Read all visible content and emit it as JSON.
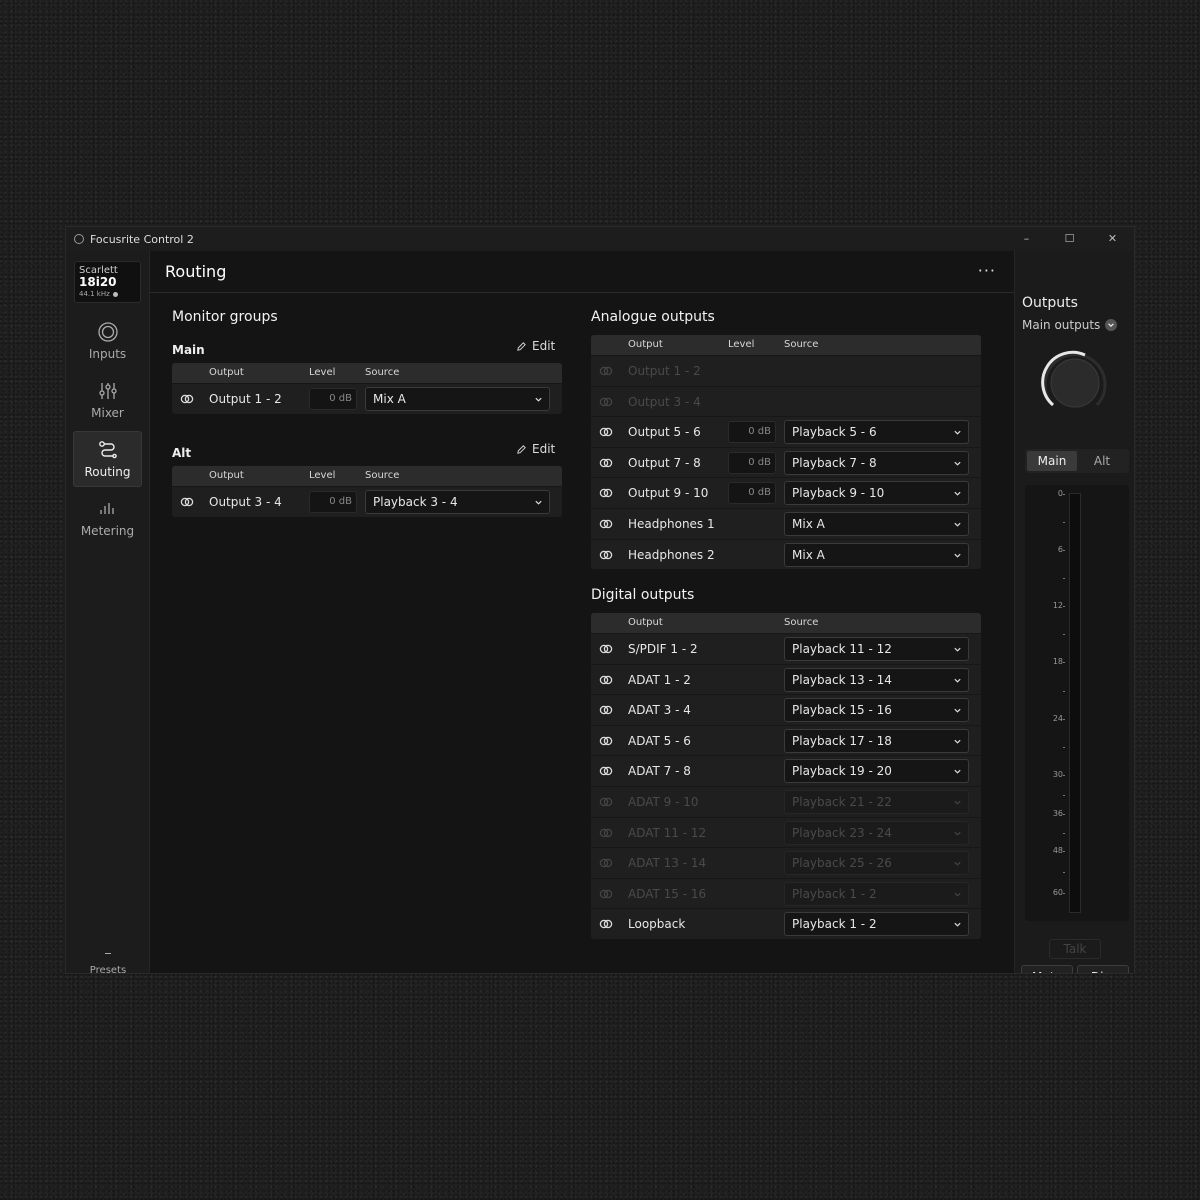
{
  "window": {
    "title": "Focusrite Control 2",
    "controls": [
      "–",
      "☐",
      "✕"
    ]
  },
  "sidebar": {
    "device": {
      "brand": "Scarlett",
      "model": "18i20",
      "rate": "44.1 kHz"
    },
    "items": [
      {
        "label": "Inputs",
        "icon": "inputs-icon"
      },
      {
        "label": "Mixer",
        "icon": "mixer-icon"
      },
      {
        "label": "Routing",
        "icon": "routing-icon"
      },
      {
        "label": "Metering",
        "icon": "metering-icon"
      }
    ],
    "presets": "Presets"
  },
  "page": {
    "title": "Routing",
    "more": "···"
  },
  "monitor": {
    "title": "Monitor groups",
    "edit_label": "Edit",
    "headers": {
      "output": "Output",
      "level": "Level",
      "source": "Source"
    },
    "main": {
      "title": "Main",
      "output": "Output 1 - 2",
      "level": "0 dB",
      "source": "Mix A"
    },
    "alt": {
      "title": "Alt",
      "output": "Output 3 - 4",
      "level": "0 dB",
      "source": "Playback 3 - 4"
    }
  },
  "analogue": {
    "title": "Analogue outputs",
    "headers": {
      "output": "Output",
      "level": "Level",
      "source": "Source"
    },
    "rows": [
      {
        "name": "Output 1 - 2",
        "level": "",
        "source": "",
        "disabled": true
      },
      {
        "name": "Output 3 - 4",
        "level": "",
        "source": "",
        "disabled": true
      },
      {
        "name": "Output 5 - 6",
        "level": "0 dB",
        "source": "Playback 5 - 6",
        "disabled": false
      },
      {
        "name": "Output 7 - 8",
        "level": "0 dB",
        "source": "Playback 7 - 8",
        "disabled": false
      },
      {
        "name": "Output 9 - 10",
        "level": "0 dB",
        "source": "Playback 9 - 10",
        "disabled": false
      },
      {
        "name": "Headphones 1",
        "level": "",
        "source": "Mix A",
        "disabled": false
      },
      {
        "name": "Headphones 2",
        "level": "",
        "source": "Mix A",
        "disabled": false
      }
    ]
  },
  "digital": {
    "title": "Digital outputs",
    "headers": {
      "output": "Output",
      "source": "Source"
    },
    "rows": [
      {
        "name": "S/PDIF 1 - 2",
        "source": "Playback 11 - 12",
        "disabled": false
      },
      {
        "name": "ADAT 1 - 2",
        "source": "Playback 13 - 14",
        "disabled": false
      },
      {
        "name": "ADAT 3 - 4",
        "source": "Playback 15 - 16",
        "disabled": false
      },
      {
        "name": "ADAT 5 - 6",
        "source": "Playback 17 - 18",
        "disabled": false
      },
      {
        "name": "ADAT 7 - 8",
        "source": "Playback 19 - 20",
        "disabled": false
      },
      {
        "name": "ADAT 9 - 10",
        "source": "Playback 21 - 22",
        "disabled": true
      },
      {
        "name": "ADAT 11 - 12",
        "source": "Playback 23 - 24",
        "disabled": true
      },
      {
        "name": "ADAT 13 - 14",
        "source": "Playback 25 - 26",
        "disabled": true
      },
      {
        "name": "ADAT 15 - 16",
        "source": "Playback 1 - 2",
        "disabled": true
      },
      {
        "name": "Loopback",
        "source": "Playback 1 - 2",
        "disabled": false
      }
    ]
  },
  "outputs_panel": {
    "title": "Outputs",
    "subtitle": "Main outputs",
    "tabs": [
      "Main",
      "Alt"
    ],
    "active_tab": "Main",
    "meter_ticks": [
      "0",
      "6",
      "12",
      "18",
      "24",
      "30",
      "36",
      "48",
      "60"
    ],
    "talk": "Talk",
    "mute": "Mute",
    "dim": "Dim"
  }
}
